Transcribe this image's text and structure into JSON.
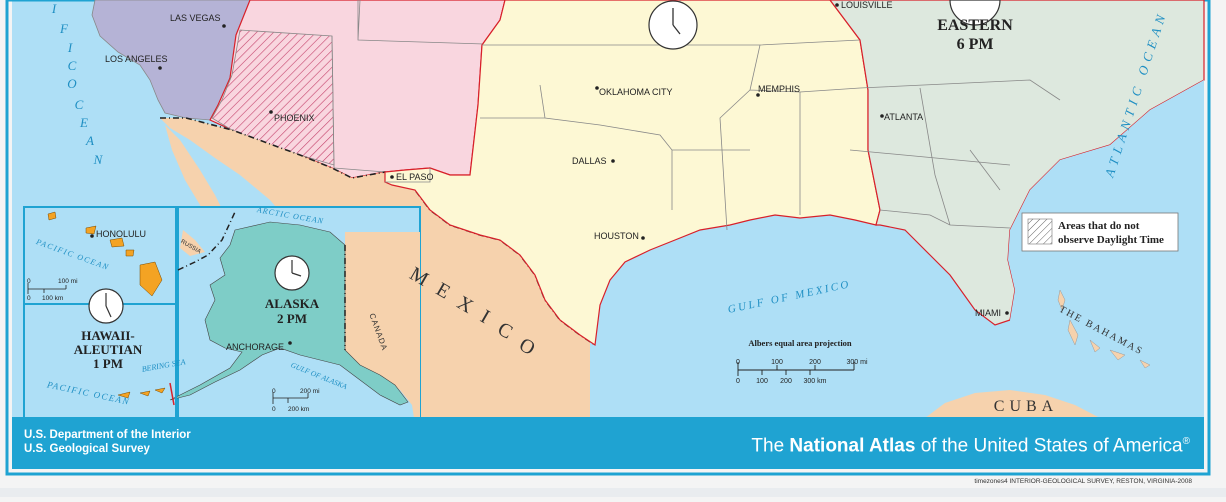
{
  "map": {
    "cities": {
      "las_vegas": "LAS VEGAS",
      "los_angeles": "LOS ANGELES",
      "phoenix": "PHOENIX",
      "el_paso": "EL PASO",
      "oklahoma_city": "OKLAHOMA CITY",
      "dallas": "DALLAS",
      "houston": "HOUSTON",
      "memphis": "MEMPHIS",
      "atlanta": "ATLANTA",
      "miami": "MIAMI",
      "louisville": "LOUISVILLE",
      "honolulu": "HONOLULU",
      "anchorage": "ANCHORAGE"
    },
    "zones": {
      "eastern_name": "EASTERN",
      "eastern_time": "6 PM",
      "alaska_name": "ALASKA",
      "alaska_time": "2 PM",
      "hawaii_name_1": "HAWAII-",
      "hawaii_name_2": "ALEUTIAN",
      "hawaii_time": "1 PM"
    },
    "water": {
      "pacific_main": [
        "I",
        "F",
        "I",
        "C",
        "O",
        "C",
        "E",
        "A",
        "N"
      ],
      "atlantic_main": "ATLANTIC OCEAN",
      "gulf_of_mexico": "GULF OF MEXICO",
      "arctic_ocean": "ARCTIC OCEAN",
      "bering_sea": "BERING SEA",
      "gulf_of_alaska": "GULF OF ALASKA",
      "pacific_inset_top": "PACIFIC OCEAN",
      "pacific_inset_bottom": "PACIFIC OCEAN"
    },
    "countries": {
      "mexico": [
        "M",
        "E",
        "X",
        "I",
        "C",
        "O"
      ],
      "canada": "CANADA",
      "russia": "RUSSIA",
      "cuba": "CUBA",
      "bahamas": "THE BAHAMAS"
    },
    "legend": {
      "line1": "Areas that do not",
      "line2": "observe Daylight Time"
    },
    "projection": {
      "title": "Albers equal area projection",
      "mi_labels": [
        "0",
        "100",
        "200",
        "300 mi"
      ],
      "km_labels": [
        "0",
        "100",
        "200",
        "300 km"
      ]
    },
    "hawaii_scale": {
      "mi_labels": [
        "0",
        "100 mi"
      ],
      "km_labels": [
        "0",
        "100 km"
      ]
    },
    "alaska_scale": {
      "mi_labels": [
        "0",
        "200 mi"
      ],
      "km_labels": [
        "0",
        "200 km"
      ]
    }
  },
  "footer": {
    "agency_line1": "U.S. Department of the Interior",
    "agency_line2": "U.S. Geological Survey",
    "brand_prefix": "The ",
    "brand_bold": "National Atlas",
    "brand_suffix": " of the United States of America",
    "brand_mark": "®",
    "credit": "timezones4  INTERIOR-GEOLOGICAL SURVEY, RESTON, VIRGINIA-2008"
  },
  "colors": {
    "ocean": "#aedff6",
    "pacific_zone": "#b5b3d6",
    "mountain_zone": "#f9d6df",
    "central_zone": "#fdf8d4",
    "eastern_zone": "#dde8de",
    "alaska_zone": "#7ecdc7",
    "hawaii_island": "#f4a323",
    "mexico": "#f6d2ad",
    "canada": "#f6d2ad",
    "cuba": "#f6d2ad",
    "footer": "#1fa3d2",
    "zone_border": "#d8202a"
  }
}
